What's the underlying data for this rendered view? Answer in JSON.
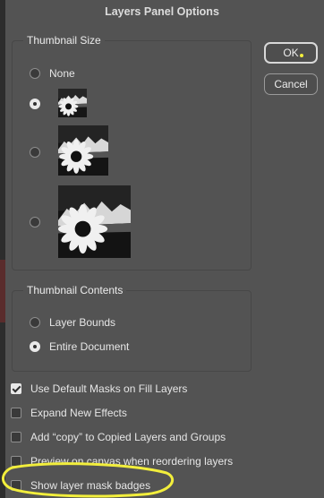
{
  "dialog": {
    "title": "Layers Panel Options"
  },
  "thumbnail_size": {
    "legend": "Thumbnail Size",
    "options": [
      {
        "label": "None",
        "selected": false
      },
      {
        "label": "",
        "selected": true,
        "size": "small"
      },
      {
        "label": "",
        "selected": false,
        "size": "medium"
      },
      {
        "label": "",
        "selected": false,
        "size": "large"
      }
    ]
  },
  "thumbnail_contents": {
    "legend": "Thumbnail Contents",
    "options": [
      {
        "label": "Layer Bounds",
        "selected": false
      },
      {
        "label": "Entire Document",
        "selected": true
      }
    ]
  },
  "buttons": {
    "ok": "OK",
    "cancel": "Cancel"
  },
  "checkboxes": [
    {
      "label": "Use Default Masks on Fill Layers",
      "checked": true
    },
    {
      "label": "Expand New Effects",
      "checked": false
    },
    {
      "label": "Add “copy” to Copied Layers and Groups",
      "checked": false
    },
    {
      "label": "Preview on canvas when reordering layers",
      "checked": false
    },
    {
      "label": "Show layer mask badges",
      "checked": false
    }
  ],
  "colors": {
    "background": "#535353",
    "annotation_highlight": "#f2ee3c",
    "selected_control": "#e9e9e9"
  }
}
